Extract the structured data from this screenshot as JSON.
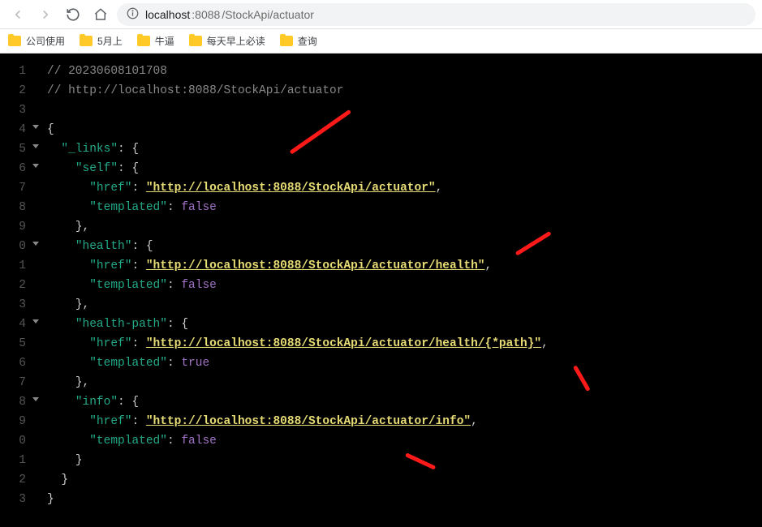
{
  "url": {
    "host": "localhost",
    "port": ":8088",
    "path": "/StockApi/actuator"
  },
  "bookmarks": [
    {
      "label": "公司使用"
    },
    {
      "label": "5月上"
    },
    {
      "label": "牛逼"
    },
    {
      "label": "每天早上必读"
    },
    {
      "label": "查询"
    }
  ],
  "json_view": {
    "comment_ts": "20230608101708",
    "comment_url": "http://localhost:8088/StockApi/actuator",
    "links_key": "\"_links\"",
    "entries": {
      "self": {
        "key": "\"self\"",
        "href_key": "\"href\"",
        "href_val": "\"http://localhost:8088/StockApi/actuator\"",
        "templated_key": "\"templated\"",
        "templated_val": "false"
      },
      "health": {
        "key": "\"health\"",
        "href_key": "\"href\"",
        "href_val": "\"http://localhost:8088/StockApi/actuator/health\"",
        "templated_key": "\"templated\"",
        "templated_val": "false"
      },
      "health_path": {
        "key": "\"health-path\"",
        "href_key": "\"href\"",
        "href_val": "\"http://localhost:8088/StockApi/actuator/health/{*path}\"",
        "templated_key": "\"templated\"",
        "templated_val": "true"
      },
      "info": {
        "key": "\"info\"",
        "href_key": "\"href\"",
        "href_val": "\"http://localhost:8088/StockApi/actuator/info\"",
        "templated_key": "\"templated\"",
        "templated_val": "false"
      }
    }
  },
  "line_numbers": [
    "1",
    "2",
    "3",
    "4",
    "5",
    "6",
    "7",
    "8",
    "9",
    "0",
    "1",
    "2",
    "3",
    "4",
    "5",
    "6",
    "7",
    "8",
    "9",
    "0",
    "1",
    "2",
    "3"
  ]
}
